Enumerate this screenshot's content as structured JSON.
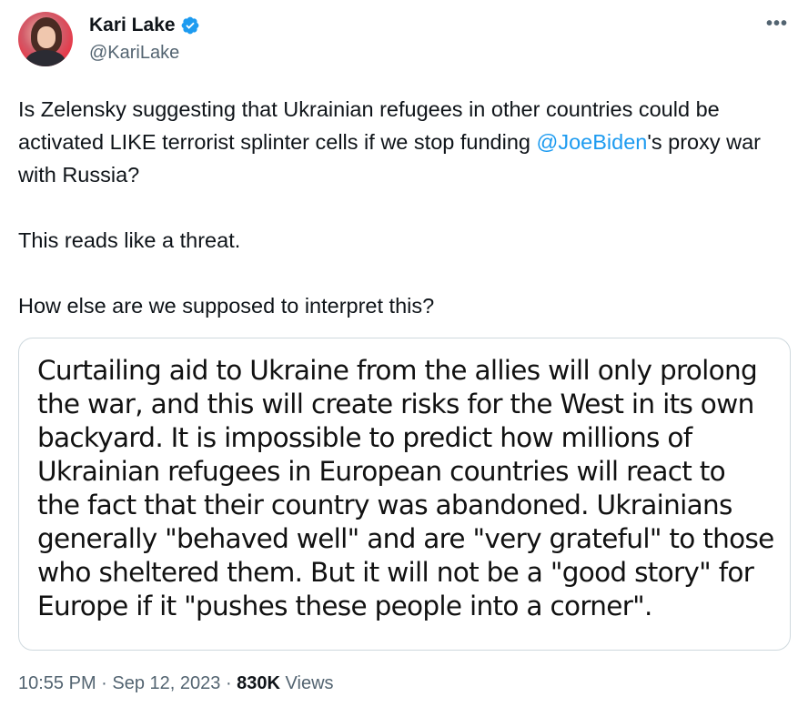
{
  "author": {
    "display_name": "Kari Lake",
    "handle": "@KariLake",
    "verified_badge_color": "#1d9bf0",
    "avatar_icon": "avatar-photo"
  },
  "more_icon": "more-horizontal-icon",
  "tweet": {
    "line1_part1": "Is Zelensky suggesting that Ukrainian refugees in other countries could be activated LIKE terrorist splinter cells if we stop funding ",
    "mention": "@JoeBiden",
    "line1_part2": "'s proxy war with Russia?",
    "paragraph2": "This reads like a threat.",
    "paragraph3": "How else are we supposed to interpret this?"
  },
  "quote_image_text": "Curtailing aid to Ukraine from the allies will only prolong the war, and this will create risks for the West in its own backyard. It is impossible to predict how millions of Ukrainian refugees in European countries will react to the fact that their country was abandoned. Ukrainians generally \"behaved well\" and are \"very grateful\" to those who sheltered them. But it will not be a \"good story\" for Europe if it \"pushes these people into a corner\".",
  "meta": {
    "time": "10:55 PM",
    "separator1": " · ",
    "date": "Sep 12, 2023",
    "separator2": " · ",
    "views_count": "830K",
    "views_label": " Views"
  },
  "colors": {
    "link": "#1d9bf0",
    "secondary_text": "#536471",
    "primary_text": "#0f1419",
    "border": "#cfd9de"
  }
}
